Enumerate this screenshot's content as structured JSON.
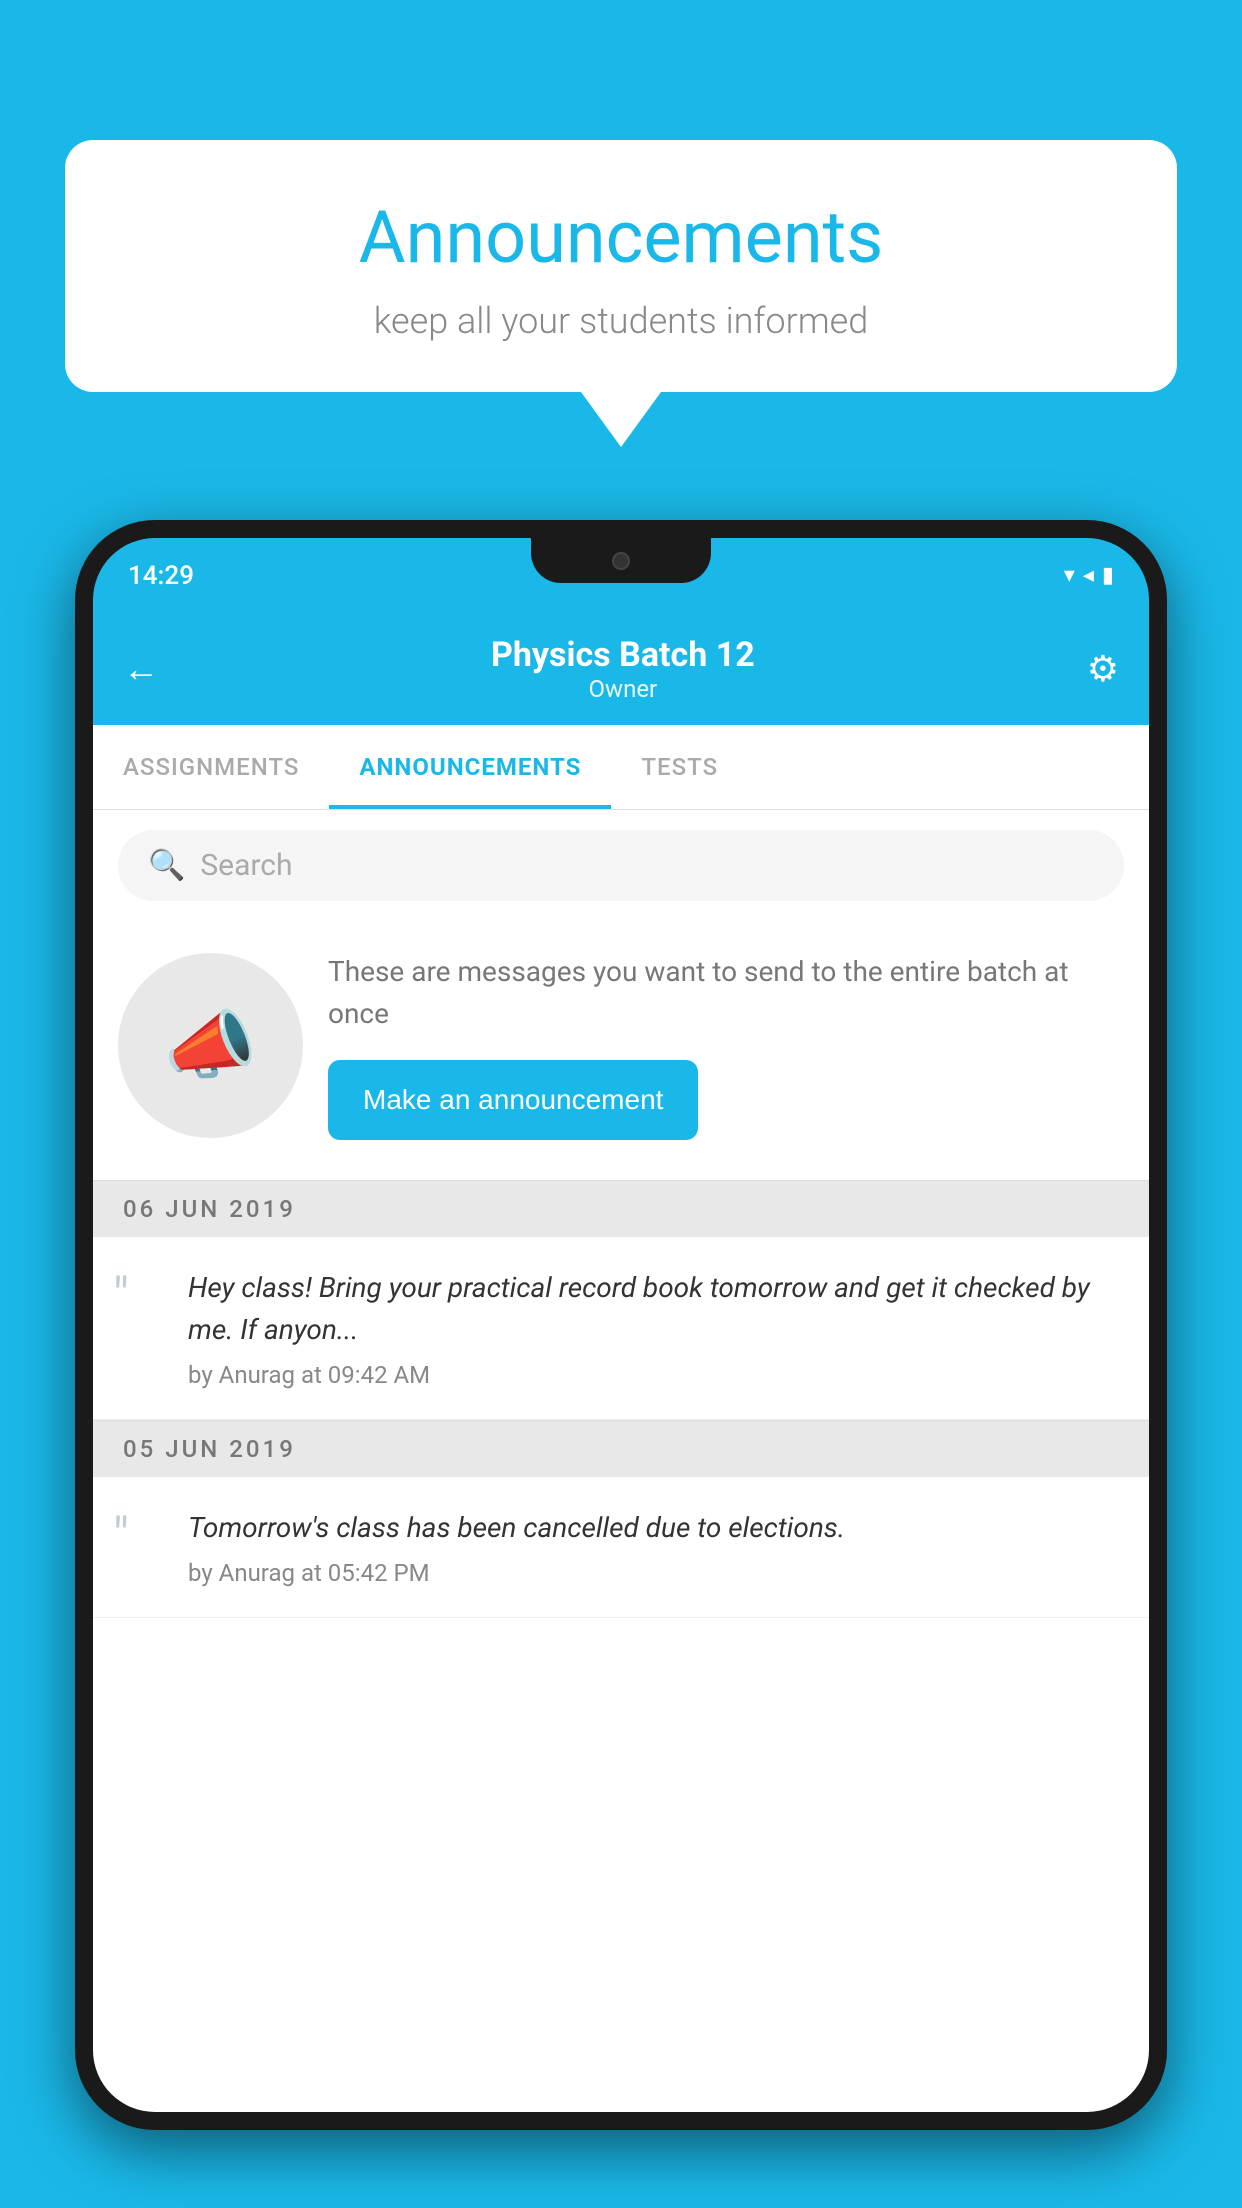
{
  "background_color": "#1ab8e8",
  "speech_bubble": {
    "title": "Announcements",
    "subtitle": "keep all your students informed"
  },
  "phone": {
    "status_bar": {
      "time": "14:29",
      "signal_wifi": "▼",
      "signal_bars": "▲◀",
      "battery": "▮"
    },
    "header": {
      "back_label": "←",
      "title": "Physics Batch 12",
      "subtitle": "Owner",
      "gear_label": "⚙"
    },
    "tabs": [
      {
        "label": "ASSIGNMENTS",
        "active": false
      },
      {
        "label": "ANNOUNCEMENTS",
        "active": true
      },
      {
        "label": "TESTS",
        "active": false
      }
    ],
    "search": {
      "placeholder": "Search"
    },
    "promo": {
      "description": "These are messages you want to send to the entire batch at once",
      "button_label": "Make an announcement"
    },
    "announcements": [
      {
        "date": "06  JUN  2019",
        "text": "Hey class! Bring your practical record book tomorrow and get it checked by me. If anyon...",
        "meta": "by Anurag at 09:42 AM"
      },
      {
        "date": "05  JUN  2019",
        "text": "Tomorrow's class has been cancelled due to elections.",
        "meta": "by Anurag at 05:42 PM"
      }
    ]
  }
}
